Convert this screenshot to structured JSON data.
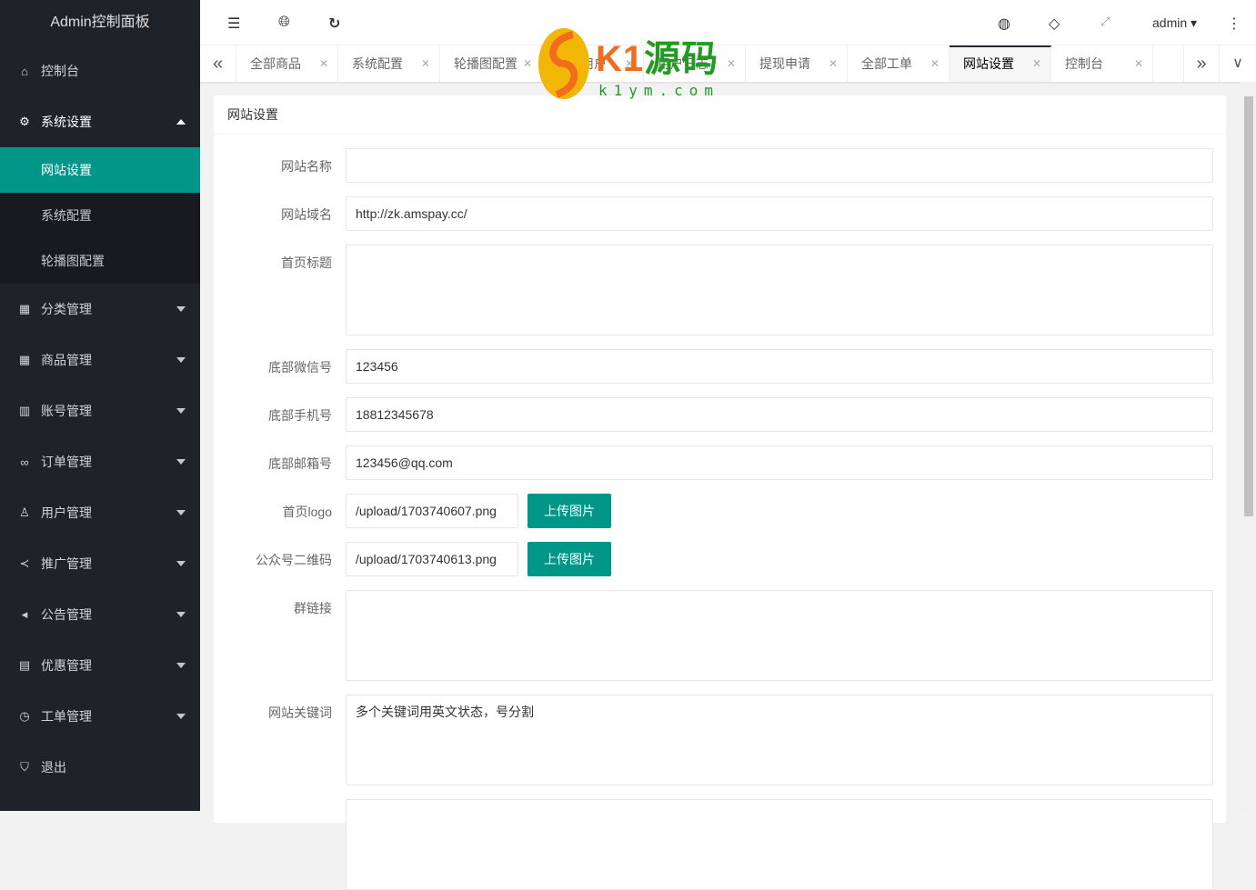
{
  "sidebar": {
    "title": "Admin控制面板",
    "items": [
      {
        "label": "控制台",
        "icon": "home-icon"
      },
      {
        "label": "系统设置",
        "icon": "gear-icon",
        "expanded": true,
        "children": [
          "网站设置",
          "系统配置",
          "轮播图配置"
        ]
      },
      {
        "label": "分类管理",
        "icon": "grid-icon"
      },
      {
        "label": "商品管理",
        "icon": "grid-icon"
      },
      {
        "label": "账号管理",
        "icon": "table-icon"
      },
      {
        "label": "订单管理",
        "icon": "link-icon"
      },
      {
        "label": "用户管理",
        "icon": "user-icon"
      },
      {
        "label": "推广管理",
        "icon": "share-icon"
      },
      {
        "label": "公告管理",
        "icon": "speaker-icon"
      },
      {
        "label": "优惠管理",
        "icon": "calendar-icon"
      },
      {
        "label": "工单管理",
        "icon": "clock-icon"
      },
      {
        "label": "退出",
        "icon": "shield-icon"
      }
    ]
  },
  "header": {
    "user": "admin"
  },
  "tabs": [
    "全部商品",
    "系统配置",
    "轮播图配置",
    "全部用户",
    "用户日志",
    "提现申请",
    "全部工单",
    "网站设置",
    "控制台"
  ],
  "active_tab": "网站设置",
  "watermark": {
    "brand": "K1源码",
    "domain": "k1ym.com"
  },
  "form": {
    "title": "网站设置",
    "upload_label": "上传图片",
    "fields": [
      {
        "label": "网站名称",
        "value": ""
      },
      {
        "label": "网站域名",
        "value": "http://zk.amspay.cc/"
      },
      {
        "label": "首页标题",
        "value": ""
      },
      {
        "label": "底部微信号",
        "value": "123456"
      },
      {
        "label": "底部手机号",
        "value": "18812345678"
      },
      {
        "label": "底部邮箱号",
        "value": "123456@qq.com"
      },
      {
        "label": "首页logo",
        "value": "/upload/1703740607.png"
      },
      {
        "label": "公众号二维码",
        "value": "/upload/1703740613.png"
      },
      {
        "label": "群链接",
        "value": ""
      },
      {
        "label": "网站关键词",
        "value": "多个关键词用英文状态，号分割"
      }
    ]
  },
  "colors": {
    "accent": "#009688",
    "sidebar": "#20222a"
  }
}
